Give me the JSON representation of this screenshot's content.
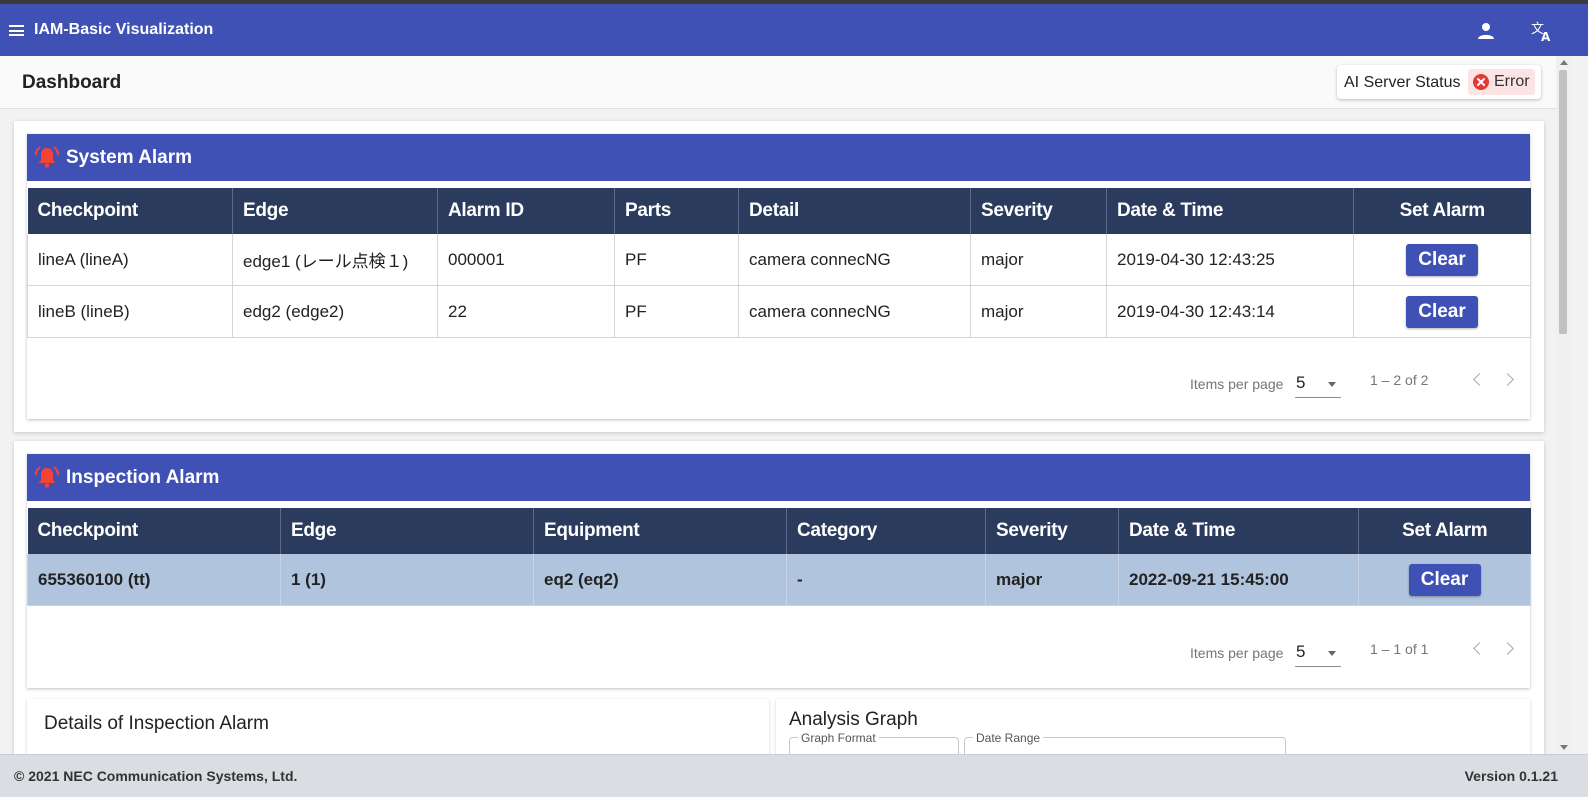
{
  "app": {
    "title": "IAM-Basic Visualization",
    "accent_color": "#3f51b5",
    "menu_icon": "menu-icon",
    "user_icon": "person-icon",
    "language_icon": "translate-icon"
  },
  "page": {
    "title": "Dashboard"
  },
  "ai_server_status": {
    "label": "AI Server Status",
    "status": "Error",
    "status_icon": "error-circle-icon",
    "status_color": "#e53935"
  },
  "system_alarm": {
    "title": "System Alarm",
    "icon": "alarm-bell-icon",
    "columns": [
      "Checkpoint",
      "Edge",
      "Alarm ID",
      "Parts",
      "Detail",
      "Severity",
      "Date & Time",
      "Set Alarm"
    ],
    "rows": [
      {
        "checkpoint": "lineA (lineA)",
        "edge": "edge1 (レール点検１)",
        "alarm_id": "000001",
        "parts": "PF",
        "detail": "camera connecNG",
        "severity": "major",
        "datetime": "2019-04-30 12:43:25",
        "action": "Clear"
      },
      {
        "checkpoint": "lineB (lineB)",
        "edge": "edg2 (edge2)",
        "alarm_id": "22",
        "parts": "PF",
        "detail": "camera connecNG",
        "severity": "major",
        "datetime": "2019-04-30 12:43:14",
        "action": "Clear"
      }
    ],
    "paginator": {
      "items_per_page_label": "Items per page",
      "items_per_page": "5",
      "range": "1 – 2 of 2"
    }
  },
  "inspection_alarm": {
    "title": "Inspection Alarm",
    "icon": "alarm-bell-icon",
    "columns": [
      "Checkpoint",
      "Edge",
      "Equipment",
      "Category",
      "Severity",
      "Date & Time",
      "Set Alarm"
    ],
    "rows": [
      {
        "checkpoint": "655360100 (tt)",
        "edge": "1 (1)",
        "equipment": "eq2 (eq2)",
        "category": "-",
        "severity": "major",
        "datetime": "2022-09-21 15:45:00",
        "action": "Clear"
      }
    ],
    "paginator": {
      "items_per_page_label": "Items per page",
      "items_per_page": "5",
      "range": "1 – 1 of 1"
    }
  },
  "details": {
    "title": "Details of Inspection Alarm"
  },
  "analysis_graph": {
    "title": "Analysis Graph",
    "graph_format_label": "Graph Format",
    "date_range_label": "Date Range"
  },
  "footer": {
    "copyright": "© 2021 NEC Communication Systems, Ltd.",
    "version": "Version 0.1.21"
  }
}
